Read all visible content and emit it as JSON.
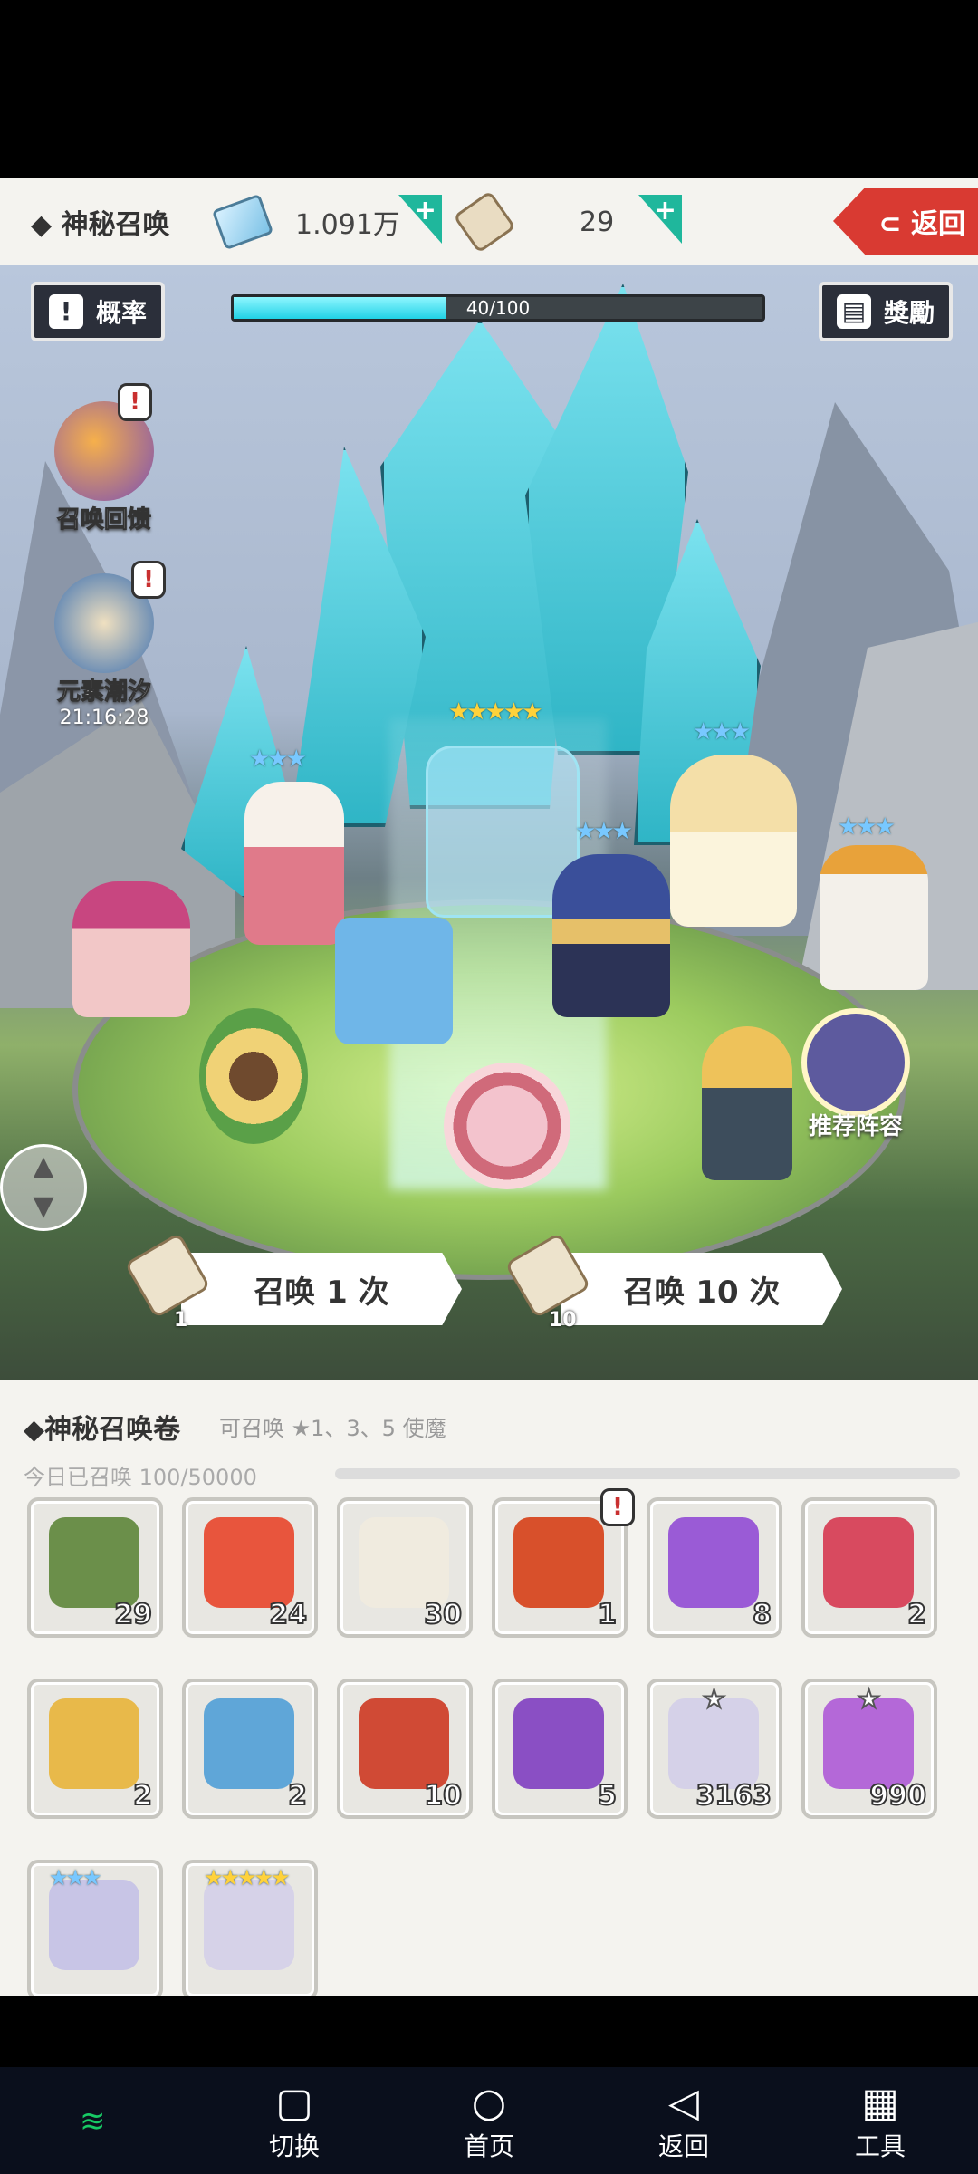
{
  "header": {
    "title": "◆ 神秘召唤",
    "gems": "1.091万",
    "scrolls": "29",
    "back_label": "⊂ 返回"
  },
  "scene": {
    "rate_label": "概率",
    "reward_label": "獎勵",
    "progress_text": "40/100",
    "progress_fraction": 0.4,
    "feedback_label": "召唤回馈",
    "tide_label": "元素潮汐",
    "tide_timer": "21:16:28",
    "recommend_label": "推荐阵容",
    "summon1_label": "召唤 1 次",
    "summon1_cost": "1",
    "summon10_label": "召唤 10 次",
    "summon10_cost": "10"
  },
  "panel": {
    "title": "◆神秘召唤卷",
    "hint": "可召唤 ★1、3、5 使魔",
    "daily": "今日已召唤 100/50000",
    "items": [
      {
        "name": "scroll-check",
        "qty": "29",
        "color": "#6b8f4a"
      },
      {
        "name": "heart",
        "qty": "24",
        "color": "#e8553d"
      },
      {
        "name": "white-scroll",
        "qty": "30",
        "color": "#f0ebdf"
      },
      {
        "name": "fire-scroll-bundle",
        "qty": "1",
        "color": "#d8502b"
      },
      {
        "name": "purple-scroll",
        "qty": "8",
        "color": "#9a5bd6"
      },
      {
        "name": "red-scroll",
        "qty": "2",
        "color": "#d84a5f"
      },
      {
        "name": "gold-scroll",
        "qty": "2",
        "color": "#e8b94a"
      },
      {
        "name": "blue-scroll",
        "qty": "2",
        "color": "#5fa6d8"
      },
      {
        "name": "red-gold-bundle",
        "qty": "10",
        "color": "#d04a35"
      },
      {
        "name": "purple-gold-bundle",
        "qty": "5",
        "color": "#8a4fc4"
      },
      {
        "name": "white-crystal",
        "qty": "3163",
        "color": "#d5d1e8"
      },
      {
        "name": "purple-crystal",
        "qty": "990",
        "color": "#b468d8"
      },
      {
        "name": "three-star-shard",
        "qty": "",
        "color": "#c8c5e6"
      },
      {
        "name": "five-star-shard",
        "qty": "",
        "color": "#d6d2e8"
      }
    ]
  },
  "nav": {
    "switch": "切换",
    "home": "首页",
    "back": "返回",
    "tools": "工具"
  }
}
